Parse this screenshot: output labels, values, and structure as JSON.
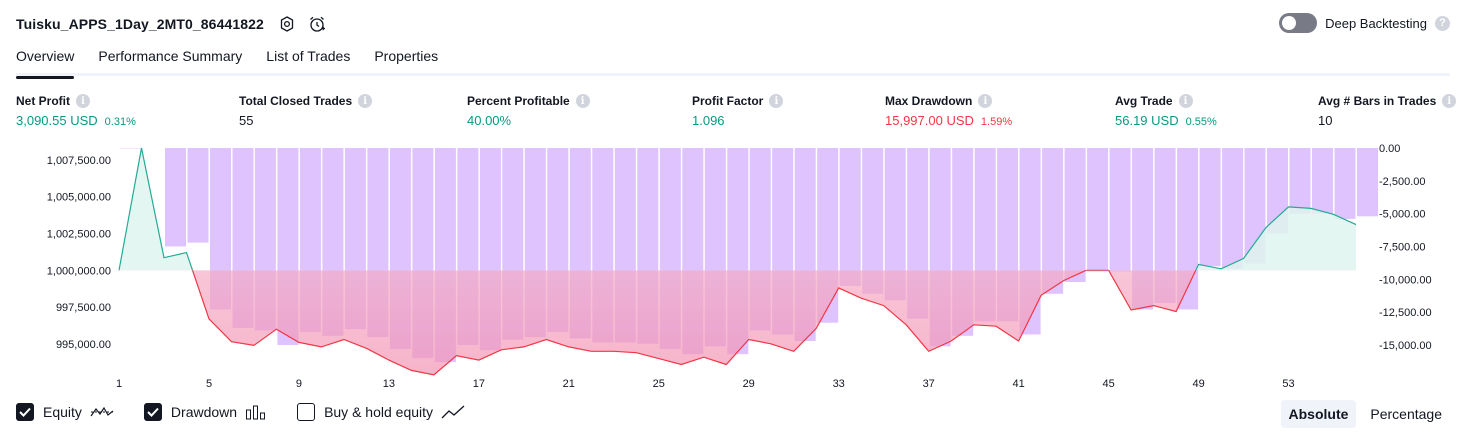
{
  "header": {
    "title": "Tuisku_APPS_1Day_2MT0_86441822",
    "settings_icon": "settings-icon",
    "alert_icon": "add-alert-icon"
  },
  "deep_backtesting": {
    "label": "Deep Backtesting",
    "enabled": false,
    "help": "?"
  },
  "tabs": [
    {
      "label": "Overview",
      "active": true
    },
    {
      "label": "Performance Summary",
      "active": false
    },
    {
      "label": "List of Trades",
      "active": false
    },
    {
      "label": "Properties",
      "active": false
    }
  ],
  "metrics": {
    "net_profit": {
      "label": "Net Profit",
      "value": "3,090.55 USD",
      "pct": "0.31%"
    },
    "total_closed_trades": {
      "label": "Total Closed Trades",
      "value": "55"
    },
    "percent_profitable": {
      "label": "Percent Profitable",
      "value": "40.00%"
    },
    "profit_factor": {
      "label": "Profit Factor",
      "value": "1.096"
    },
    "max_drawdown": {
      "label": "Max Drawdown",
      "value": "15,997.00 USD",
      "pct": "1.59%"
    },
    "avg_trade": {
      "label": "Avg Trade",
      "value": "56.19 USD",
      "pct": "0.55%"
    },
    "avg_bars": {
      "label": "Avg # Bars in Trades",
      "value": "10"
    }
  },
  "info_glyph": "i",
  "colors": {
    "positive": "#089981",
    "negative": "#f23645",
    "drawdown_bar": "#dbbcff",
    "equity_above_line": "#22ab94",
    "equity_below_line": "#f23645",
    "equity_above_fill": "#dff4ef",
    "equity_below_fill": "#f4aac0"
  },
  "chart_data": {
    "type": "area",
    "x_ticks": [
      "1",
      "5",
      "9",
      "13",
      "17",
      "21",
      "25",
      "29",
      "33",
      "37",
      "41",
      "45",
      "49",
      "53"
    ],
    "left_axis_ticks": [
      "1,007,500.00",
      "1,005,000.00",
      "1,002,500.00",
      "1,000,000.00",
      "997,500.00",
      "995,000.00"
    ],
    "right_axis_ticks": [
      "0.00",
      "-2,500.00",
      "-5,000.00",
      "-7,500.00",
      "-10,000.00",
      "-12,500.00",
      "-15,000.00"
    ],
    "equity_baseline": 1000000,
    "ylim_left": [
      993500,
      1008300
    ],
    "ylim_right": [
      -16600,
      0
    ],
    "x_range": [
      1,
      56
    ],
    "series": [
      {
        "name": "Equity",
        "type": "line",
        "x": [
          1,
          2,
          3,
          4,
          5,
          6,
          7,
          8,
          9,
          10,
          11,
          12,
          13,
          14,
          15,
          16,
          17,
          18,
          19,
          20,
          21,
          22,
          23,
          24,
          25,
          26,
          27,
          28,
          29,
          30,
          31,
          32,
          33,
          34,
          35,
          36,
          37,
          38,
          39,
          40,
          41,
          42,
          43,
          44,
          45,
          46,
          47,
          48,
          49,
          50,
          51,
          52,
          53,
          54,
          55,
          56
        ],
        "values": [
          1000000,
          1008300,
          1000850,
          1001200,
          996700,
          995150,
          994900,
          996000,
          995100,
          994800,
          995300,
          994700,
          993900,
          993200,
          992900,
          994200,
          993900,
          994600,
          994800,
          995300,
          994800,
          994500,
          994500,
          994400,
          994000,
          993600,
          994100,
          993600,
          995300,
          995000,
          994500,
          996050,
          998800,
          998100,
          997600,
          996300,
          994500,
          995200,
          996300,
          996200,
          995200,
          998300,
          999300,
          1000000,
          1000000,
          997300,
          997600,
          997200,
          1000400,
          1000100,
          1000800,
          1002900,
          1004300,
          1004200,
          1003800,
          1003100
        ]
      },
      {
        "name": "Drawdown",
        "type": "bar",
        "x": [
          1,
          2,
          3,
          4,
          5,
          6,
          7,
          8,
          9,
          10,
          11,
          12,
          13,
          14,
          15,
          16,
          17,
          18,
          19,
          20,
          21,
          22,
          23,
          24,
          25,
          26,
          27,
          28,
          29,
          30,
          31,
          32,
          33,
          34,
          35,
          36,
          37,
          38,
          39,
          40,
          41,
          42,
          43,
          44,
          45,
          46,
          47,
          48,
          49,
          50,
          51,
          52,
          53,
          54,
          55,
          56
        ],
        "values": [
          -30,
          0,
          -7500,
          -7200,
          -12300,
          -13700,
          -13900,
          -15000,
          -14000,
          -14300,
          -13800,
          -14400,
          -15300,
          -16000,
          -16300,
          -15000,
          -15400,
          -14600,
          -14400,
          -14000,
          -14500,
          -14800,
          -14800,
          -14900,
          -15300,
          -15700,
          -15100,
          -15700,
          -13900,
          -14200,
          -14700,
          -13300,
          -10500,
          -11100,
          -11600,
          -13000,
          -15100,
          -14300,
          -13200,
          -13200,
          -14200,
          -11100,
          -10200,
          -9400,
          -9400,
          -12300,
          -11800,
          -12300,
          -9000,
          -9200,
          -8800,
          -6500,
          -5000,
          -5000,
          -5400,
          -5200
        ]
      }
    ],
    "legend": [
      "Equity",
      "Drawdown",
      "Buy & hold equity"
    ]
  },
  "legend": {
    "equity": {
      "label": "Equity",
      "checked": true
    },
    "drawdown": {
      "label": "Drawdown",
      "checked": true
    },
    "buy_hold": {
      "label": "Buy & hold equity",
      "checked": false
    }
  },
  "mode": {
    "absolute": {
      "label": "Absolute",
      "active": true
    },
    "percentage": {
      "label": "Percentage",
      "active": false
    }
  }
}
